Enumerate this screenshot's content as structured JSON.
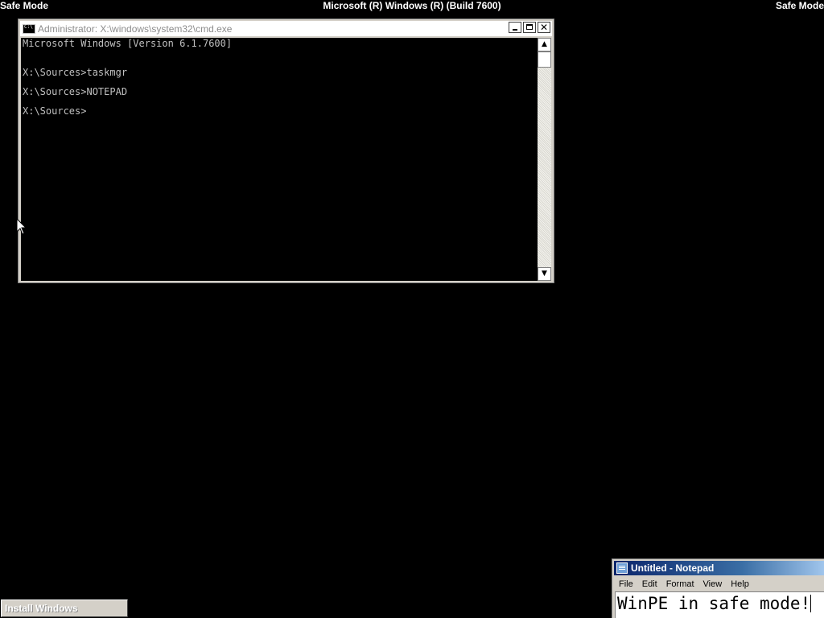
{
  "overlay": {
    "left_label": "Safe Mode",
    "center_label": "Microsoft (R) Windows (R) (Build 7600)",
    "right_label": "Safe Mode"
  },
  "cmd_window": {
    "title": "Administrator: X:\\windows\\system32\\cmd.exe",
    "buttons": {
      "close_glyph": "✕"
    },
    "scrollbar": {
      "up_glyph": "▲",
      "down_glyph": "▼"
    },
    "lines": [
      "Microsoft Windows [Version 6.1.7600]",
      "",
      "X:\\Sources>taskmgr",
      "",
      "X:\\Sources>NOTEPAD",
      "",
      "X:\\Sources>"
    ]
  },
  "notepad": {
    "title": "Untitled - Notepad",
    "menu": [
      "File",
      "Edit",
      "Format",
      "View",
      "Help"
    ],
    "content": "WinPE in safe mode!"
  },
  "taskbar": {
    "install_button_label": "Install Windows"
  },
  "colors": {
    "desktop_background": "#000000",
    "console_text": "#c0c0c0",
    "inactive_title_text": "#8c8c8c",
    "active_title_start": "#0a246a",
    "active_title_end": "#a6caf0"
  },
  "icons": {
    "cmd_window_icon": "command-prompt-icon",
    "notepad_window_icon": "notepad-icon",
    "mouse_cursor": "arrow-cursor-icon"
  }
}
